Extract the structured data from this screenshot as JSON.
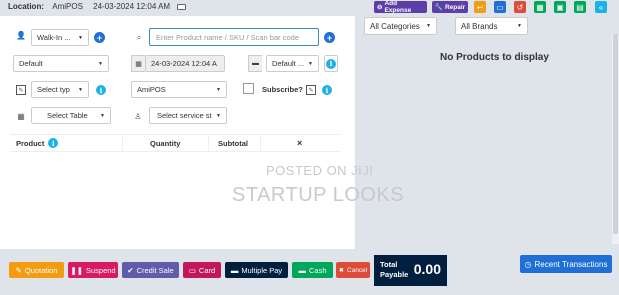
{
  "topbar": {
    "location_label": "Location:",
    "location_value": "AmiPOS",
    "datetime": "24-03-2024 12:04 AM",
    "add_expense": "Add Expense",
    "repair": "Repair"
  },
  "form": {
    "customer": "Walk-In ...",
    "search_placeholder": "Enter Product name / SKU / Scan bar code",
    "price_group": "Default",
    "date": "24-03-2024 12:04 A",
    "account": "Default ...",
    "types": "Select typ",
    "location": "AmiPOS",
    "subscribe": "Subscribe?",
    "table": "Select Table",
    "service_staff": "Select service st"
  },
  "table": {
    "columns": [
      "Product",
      "Quantity",
      "Subtotal",
      "×"
    ]
  },
  "watermark": {
    "line1": "POSTED ON JIJI",
    "line2": "STARTUP LOOKS"
  },
  "right": {
    "categories": "All Categories",
    "brands": "All Brands",
    "empty": "No Products to display"
  },
  "footer": {
    "quotation": "Quotation",
    "suspend": "Suspend",
    "credit_sale": "Credit Sale",
    "card": "Card",
    "multiple_pay": "Multiple Pay",
    "cash": "Cash",
    "cancel": "Cancel",
    "total_label_1": "Total",
    "total_label_2": "Payable",
    "total_value": "0.00",
    "recent": "Recent Transactions"
  },
  "colors": {
    "quotation": "#f39c12",
    "suspend": "#d81b60",
    "credit_sale": "#605ca8",
    "card": "#c2185b",
    "multiple_pay": "#001f3f",
    "cash": "#00a65a",
    "cancel": "#dd4b39",
    "primary": "#1f6fd6"
  }
}
